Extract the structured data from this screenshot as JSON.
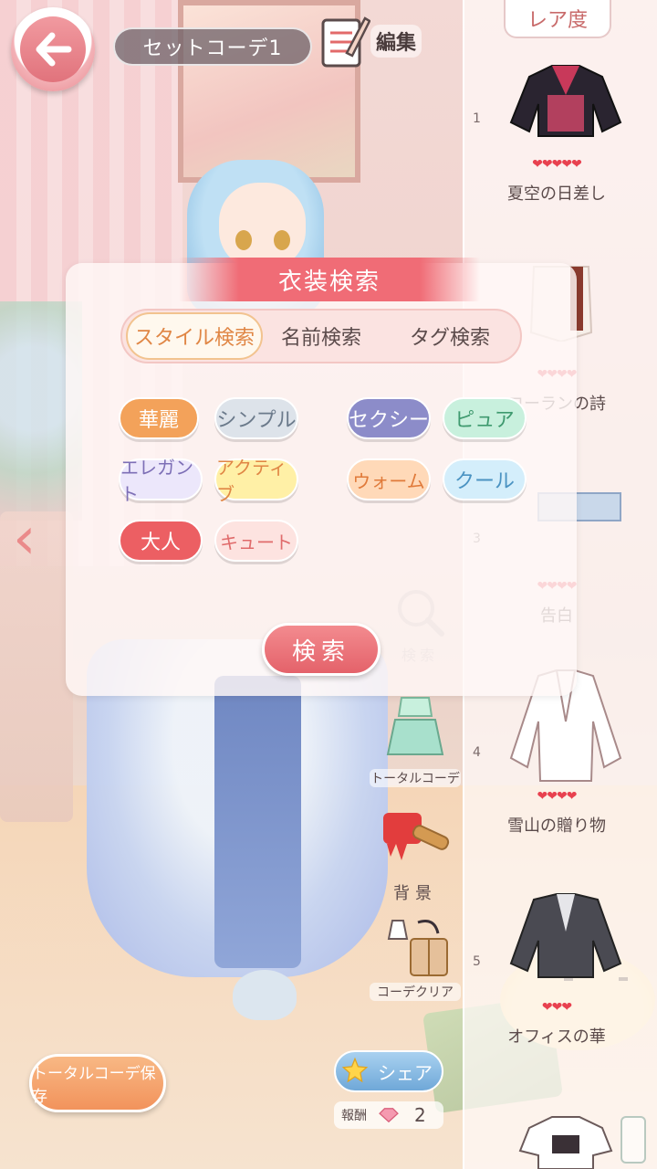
{
  "header": {
    "set_name": "セットコーデ1",
    "edit_label": "編集"
  },
  "rarity_panel": {
    "title": "レア度",
    "items": [
      {
        "num": "1",
        "hearts": "❤❤❤❤❤",
        "name": "夏空の日差し"
      },
      {
        "num": "",
        "hearts": "❤❤❤❤",
        "name": "コーランの詩"
      },
      {
        "num": "3",
        "hearts": "❤❤❤❤",
        "name": "告白"
      },
      {
        "num": "4",
        "hearts": "❤❤❤❤",
        "name": "雪山の贈り物"
      },
      {
        "num": "5",
        "hearts": "❤❤❤",
        "name": "オフィスの華"
      }
    ]
  },
  "search_dialog": {
    "title": "衣装検索",
    "tabs": [
      {
        "label": "スタイル検索",
        "active": true
      },
      {
        "label": "名前検索",
        "active": false
      },
      {
        "label": "タグ検索",
        "active": false
      }
    ],
    "styles": [
      {
        "label": "華麗",
        "color": "#f3a25a"
      },
      {
        "label": "シンプル",
        "color": "#dde3ea"
      },
      {
        "label": "セクシー",
        "color": "#8c8cc9"
      },
      {
        "label": "ピュア",
        "color": "#c8f0dd"
      },
      {
        "label": "エレガント",
        "color": "#ece7fb"
      },
      {
        "label": "アクティブ",
        "color": "#fff0a6"
      },
      {
        "label": "ウォーム",
        "color": "#ffd9b8"
      },
      {
        "label": "クール",
        "color": "#d4eefb"
      },
      {
        "label": "大人",
        "color": "#ec5f63"
      },
      {
        "label": "キュート",
        "color": "#fde3e0"
      }
    ],
    "search_label": "検索"
  },
  "side_buttons": {
    "search_faded": "検索",
    "total_coordinate": "トータルコーデ",
    "background": "背景",
    "clear": "コーデクリア"
  },
  "footer": {
    "save_label": "トータルコーデ保存",
    "share_label": "シェア",
    "reward_label": "報酬",
    "reward_count": "2"
  },
  "colors": {
    "accent_red": "#f06c76",
    "back_button": "#e1737c"
  }
}
